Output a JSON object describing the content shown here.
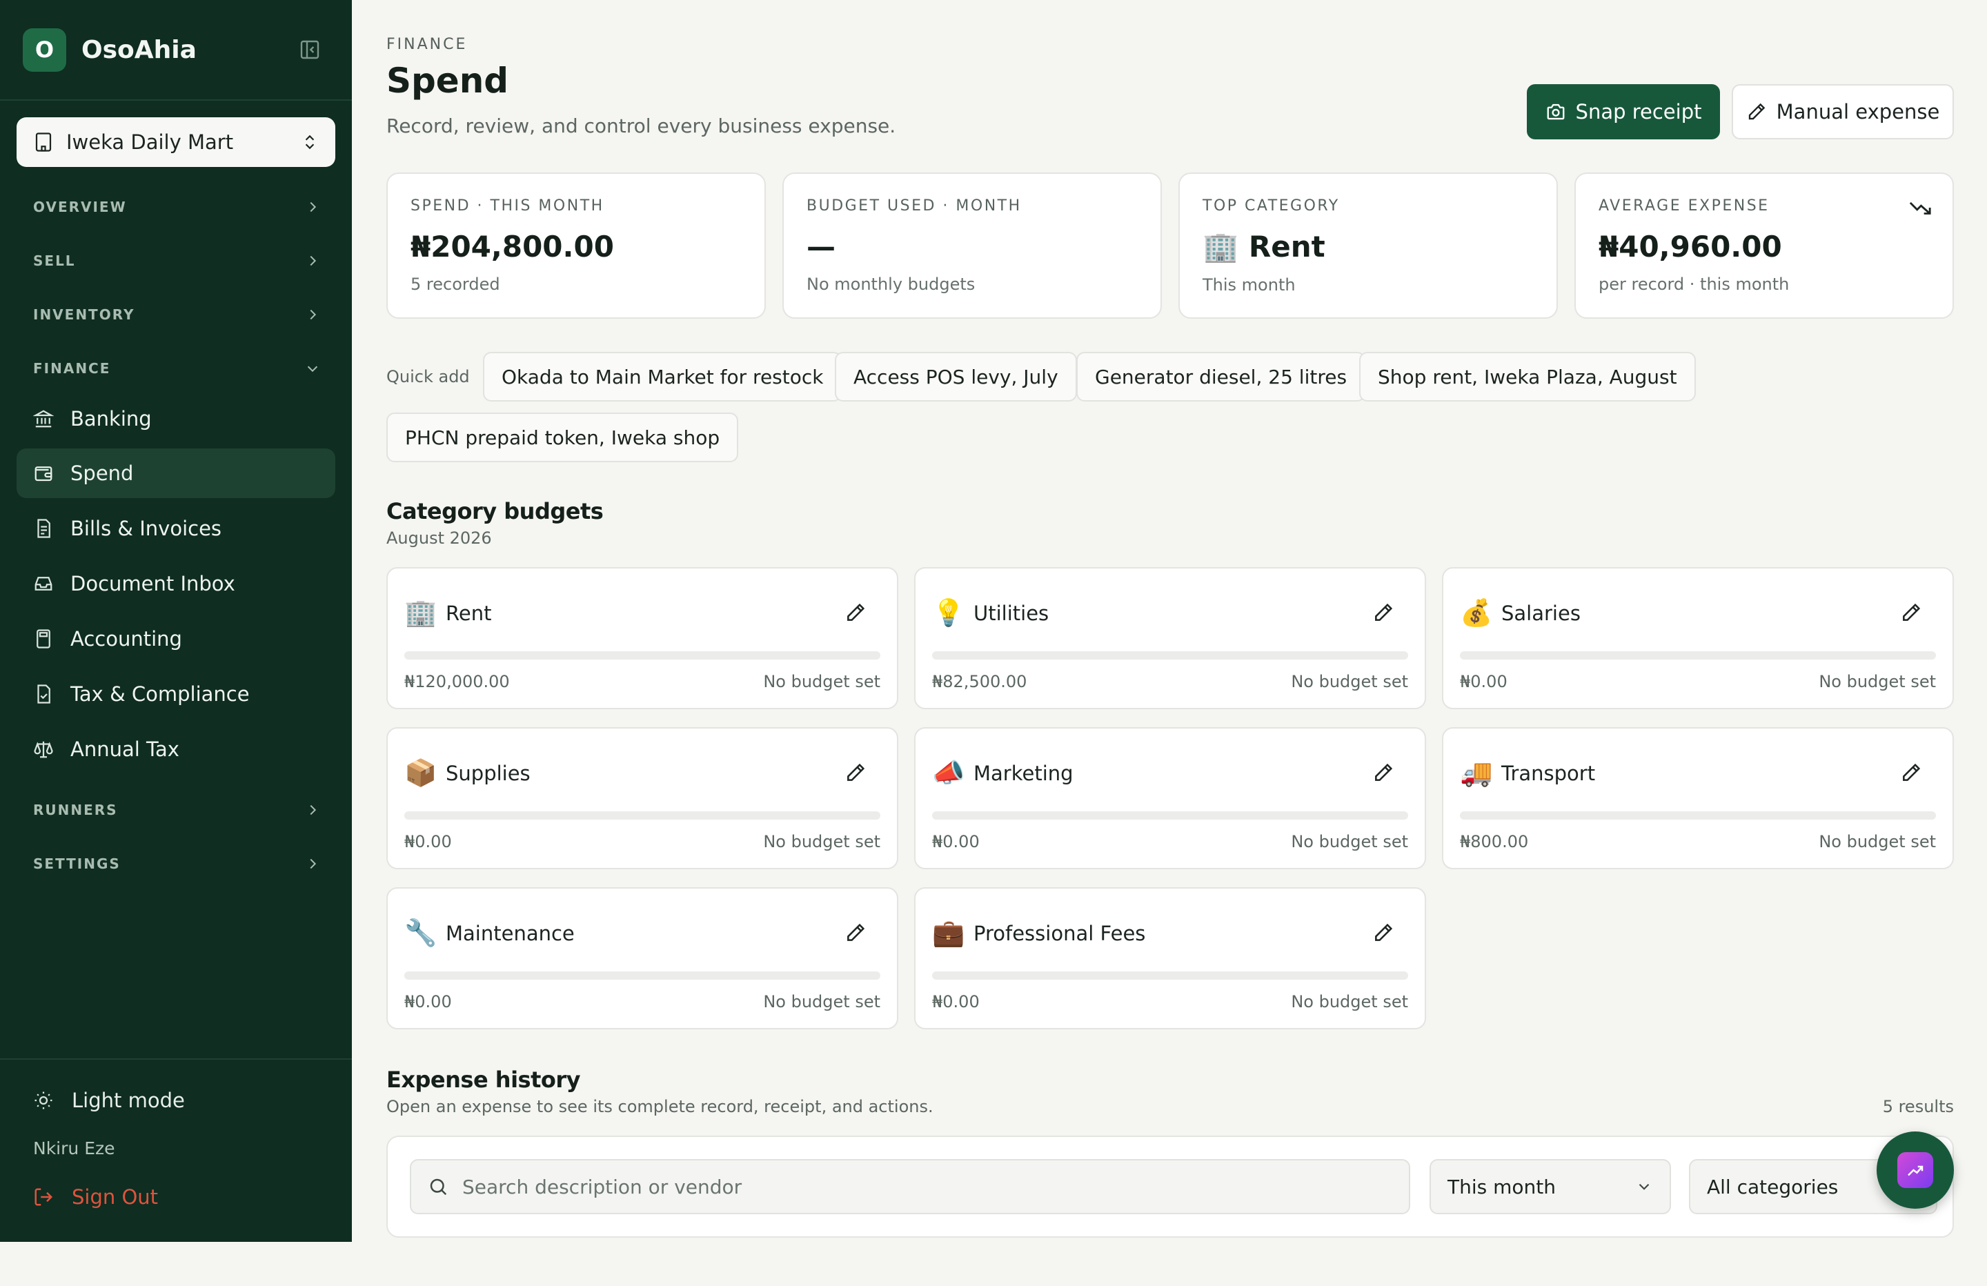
{
  "brand": {
    "initial": "O",
    "name": "OsoAhia"
  },
  "store": {
    "name": "Iweka Daily Mart"
  },
  "sidebar": {
    "sections": {
      "overview": "OVERVIEW",
      "sell": "SELL",
      "inventory": "INVENTORY",
      "finance": "FINANCE",
      "runners": "RUNNERS",
      "settings": "SETTINGS"
    },
    "finance_items": [
      {
        "label": "Banking",
        "icon": "bank-icon"
      },
      {
        "label": "Spend",
        "icon": "wallet-icon",
        "active": true
      },
      {
        "label": "Bills & Invoices",
        "icon": "receipt-icon"
      },
      {
        "label": "Document Inbox",
        "icon": "inbox-icon"
      },
      {
        "label": "Accounting",
        "icon": "calculator-icon"
      },
      {
        "label": "Tax & Compliance",
        "icon": "file-check-icon"
      },
      {
        "label": "Annual Tax",
        "icon": "scale-icon"
      }
    ],
    "theme_label": "Light mode",
    "user_name": "Nkiru Eze",
    "sign_out": "Sign Out"
  },
  "header": {
    "eyebrow": "FINANCE",
    "title": "Spend",
    "subtitle": "Record, review, and control every business expense.",
    "snap_receipt": "Snap receipt",
    "manual_expense": "Manual expense"
  },
  "stats": [
    {
      "label": "SPEND · THIS MONTH",
      "value": "₦204,800.00",
      "sub": "5 recorded"
    },
    {
      "label": "BUDGET USED · MONTH",
      "value": "—",
      "sub": "No monthly budgets"
    },
    {
      "label": "TOP CATEGORY",
      "value": "🏢 Rent",
      "sub": "This month"
    },
    {
      "label": "AVERAGE EXPENSE",
      "value": "₦40,960.00",
      "sub": "per record · this month"
    }
  ],
  "quick_add": {
    "label": "Quick add",
    "chips": [
      "Okada to Main Market for restock",
      "Access POS levy, July",
      "Generator diesel, 25 litres",
      "Shop rent, Iweka Plaza, August",
      "PHCN prepaid token, Iweka shop"
    ]
  },
  "budgets": {
    "title": "Category budgets",
    "period": "August 2026",
    "no_budget": "No budget set",
    "items": [
      {
        "emoji": "🏢",
        "name": "Rent",
        "amount": "₦120,000.00"
      },
      {
        "emoji": "💡",
        "name": "Utilities",
        "amount": "₦82,500.00"
      },
      {
        "emoji": "💰",
        "name": "Salaries",
        "amount": "₦0.00"
      },
      {
        "emoji": "📦",
        "name": "Supplies",
        "amount": "₦0.00"
      },
      {
        "emoji": "📣",
        "name": "Marketing",
        "amount": "₦0.00"
      },
      {
        "emoji": "🚚",
        "name": "Transport",
        "amount": "₦800.00"
      },
      {
        "emoji": "🔧",
        "name": "Maintenance",
        "amount": "₦0.00"
      },
      {
        "emoji": "💼",
        "name": "Professional Fees",
        "amount": "₦0.00"
      }
    ]
  },
  "history": {
    "title": "Expense history",
    "subtitle": "Open an expense to see its complete record, receipt, and actions.",
    "results": "5 results",
    "search_placeholder": "Search description or vendor",
    "period_filter": "This month",
    "category_filter": "All categories"
  },
  "colors": {
    "sidebar_bg": "#0f2d21",
    "primary": "#17583b",
    "danger": "#e0533d",
    "page_bg": "#f5f5f2"
  }
}
